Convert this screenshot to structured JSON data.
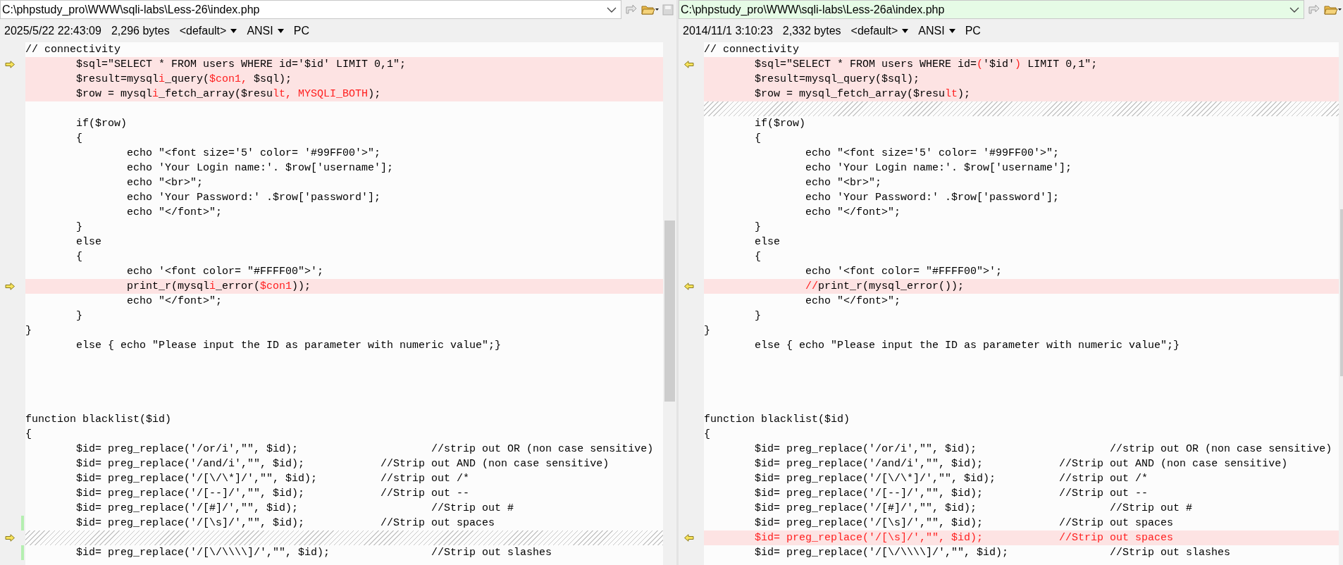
{
  "panes": [
    {
      "path": "C:\\phpstudy_pro\\WWW\\sqli-labs\\Less-26\\index.php",
      "path_active": false,
      "show_save": true,
      "info": {
        "timestamp": "2025/5/22 22:43:09",
        "size": "2,296 bytes",
        "codepage": "<default>",
        "encoding": "ANSI",
        "eol": "PC"
      },
      "lines": [
        {
          "kind": "plain",
          "text": "// connectivity"
        },
        {
          "kind": "changed",
          "arrow": true,
          "segments": [
            {
              "text": "\t$sql=\"SELECT * FROM users WHERE id='$id' LIMIT 0,1\";",
              "changed": false
            }
          ]
        },
        {
          "kind": "changed",
          "segments": [
            {
              "text": "\t$result=mysql",
              "changed": false
            },
            {
              "text": "i",
              "changed": true
            },
            {
              "text": "_query(",
              "changed": false
            },
            {
              "text": "$con1,",
              "changed": true
            },
            {
              "text": " $sql);",
              "changed": false
            }
          ]
        },
        {
          "kind": "changed",
          "segments": [
            {
              "text": "\t$row = mysql",
              "changed": false
            },
            {
              "text": "i",
              "changed": true
            },
            {
              "text": "_fetch_array($resu",
              "changed": false
            },
            {
              "text": "lt, MYSQLI_BOTH",
              "changed": true
            },
            {
              "text": ");",
              "changed": false
            }
          ]
        },
        {
          "kind": "empty"
        },
        {
          "kind": "plain",
          "text": "\tif($row)"
        },
        {
          "kind": "plain",
          "text": "\t{"
        },
        {
          "kind": "plain",
          "text": "\t\techo \"<font size='5' color= '#99FF00'>\";"
        },
        {
          "kind": "plain",
          "text": "\t\techo 'Your Login name:'. $row['username'];"
        },
        {
          "kind": "plain",
          "text": "\t\techo \"<br>\";"
        },
        {
          "kind": "plain",
          "text": "\t\techo 'Your Password:' .$row['password'];"
        },
        {
          "kind": "plain",
          "text": "\t\techo \"</font>\";"
        },
        {
          "kind": "plain",
          "text": "\t}"
        },
        {
          "kind": "plain",
          "text": "\telse"
        },
        {
          "kind": "plain",
          "text": "\t{"
        },
        {
          "kind": "plain",
          "text": "\t\techo '<font color= \"#FFFF00\">';"
        },
        {
          "kind": "changed",
          "arrow": true,
          "segments": [
            {
              "text": "\t\tprint_r(mysql",
              "changed": false
            },
            {
              "text": "i",
              "changed": true
            },
            {
              "text": "_error(",
              "changed": false
            },
            {
              "text": "$con1",
              "changed": true
            },
            {
              "text": "));",
              "changed": false
            }
          ]
        },
        {
          "kind": "plain",
          "text": "\t\techo \"</font>\";"
        },
        {
          "kind": "plain",
          "text": "\t}"
        },
        {
          "kind": "plain",
          "text": "}"
        },
        {
          "kind": "plain",
          "text": "\telse { echo \"Please input the ID as parameter with numeric value\";}"
        },
        {
          "kind": "empty"
        },
        {
          "kind": "empty"
        },
        {
          "kind": "empty"
        },
        {
          "kind": "empty"
        },
        {
          "kind": "plain",
          "text": "function blacklist($id)"
        },
        {
          "kind": "plain",
          "text": "{"
        },
        {
          "kind": "plain",
          "text": "\t$id= preg_replace('/or/i',\"\", $id);\t\t\t//strip out OR (non case sensitive)"
        },
        {
          "kind": "plain",
          "text": "\t$id= preg_replace('/and/i',\"\", $id);\t\t//Strip out AND (non case sensitive)"
        },
        {
          "kind": "plain",
          "text": "\t$id= preg_replace('/[\\/\\*]/',\"\", $id);\t\t//strip out /*"
        },
        {
          "kind": "plain",
          "text": "\t$id= preg_replace('/[--]/',\"\", $id);\t\t//Strip out --"
        },
        {
          "kind": "plain",
          "text": "\t$id= preg_replace('/[#]/',\"\", $id);\t\t\t//Strip out #"
        },
        {
          "kind": "plain",
          "moved": true,
          "text": "\t$id= preg_replace('/[\\s]/',\"\", $id);\t\t//Strip out spaces"
        },
        {
          "kind": "filler",
          "arrow": true
        },
        {
          "kind": "plain",
          "moved": true,
          "text": "\t$id= preg_replace('/[\\/\\\\\\\\]/',\"\", $id);\t\t//Strip out slashes"
        }
      ]
    },
    {
      "path": "C:\\phpstudy_pro\\WWW\\sqli-labs\\Less-26a\\index.php",
      "path_active": true,
      "show_save": false,
      "info": {
        "timestamp": "2014/11/1 3:10:23",
        "size": "2,332 bytes",
        "codepage": "<default>",
        "encoding": "ANSI",
        "eol": "PC"
      },
      "lines": [
        {
          "kind": "plain",
          "text": "// connectivity"
        },
        {
          "kind": "changed",
          "arrow": true,
          "segments": [
            {
              "text": "\t$sql=\"SELECT * FROM users WHERE id=",
              "changed": false
            },
            {
              "text": "(",
              "changed": true
            },
            {
              "text": "'$id'",
              "changed": false
            },
            {
              "text": ")",
              "changed": true
            },
            {
              "text": " LIMIT 0,1\";",
              "changed": false
            }
          ]
        },
        {
          "kind": "changed",
          "segments": [
            {
              "text": "\t$result=mysql_query($sql);",
              "changed": false
            }
          ]
        },
        {
          "kind": "changed",
          "segments": [
            {
              "text": "\t$row = mysql_fetch_array($resu",
              "changed": false
            },
            {
              "text": "lt",
              "changed": true
            },
            {
              "text": ");",
              "changed": false
            }
          ]
        },
        {
          "kind": "filler"
        },
        {
          "kind": "plain",
          "text": "\tif($row)"
        },
        {
          "kind": "plain",
          "text": "\t{"
        },
        {
          "kind": "plain",
          "text": "\t\techo \"<font size='5' color= '#99FF00'>\";"
        },
        {
          "kind": "plain",
          "text": "\t\techo 'Your Login name:'. $row['username'];"
        },
        {
          "kind": "plain",
          "text": "\t\techo \"<br>\";"
        },
        {
          "kind": "plain",
          "text": "\t\techo 'Your Password:' .$row['password'];"
        },
        {
          "kind": "plain",
          "text": "\t\techo \"</font>\";"
        },
        {
          "kind": "plain",
          "text": "\t}"
        },
        {
          "kind": "plain",
          "text": "\telse"
        },
        {
          "kind": "plain",
          "text": "\t{"
        },
        {
          "kind": "plain",
          "text": "\t\techo '<font color= \"#FFFF00\">';"
        },
        {
          "kind": "changed",
          "arrow": true,
          "segments": [
            {
              "text": "\t\t//",
              "changed": true
            },
            {
              "text": "print_r(mysql_error());",
              "changed": false
            }
          ]
        },
        {
          "kind": "plain",
          "text": "\t\techo \"</font>\";"
        },
        {
          "kind": "plain",
          "text": "\t}"
        },
        {
          "kind": "plain",
          "text": "}"
        },
        {
          "kind": "plain",
          "text": "\telse { echo \"Please input the ID as parameter with numeric value\";}"
        },
        {
          "kind": "empty"
        },
        {
          "kind": "empty"
        },
        {
          "kind": "empty"
        },
        {
          "kind": "empty"
        },
        {
          "kind": "plain",
          "text": "function blacklist($id)"
        },
        {
          "kind": "plain",
          "text": "{"
        },
        {
          "kind": "plain",
          "text": "\t$id= preg_replace('/or/i',\"\", $id);\t\t\t//strip out OR (non case sensitive)"
        },
        {
          "kind": "plain",
          "text": "\t$id= preg_replace('/and/i',\"\", $id);\t\t//Strip out AND (non case sensitive)"
        },
        {
          "kind": "plain",
          "text": "\t$id= preg_replace('/[\\/\\*]/',\"\", $id);\t\t//strip out /*"
        },
        {
          "kind": "plain",
          "text": "\t$id= preg_replace('/[--]/',\"\", $id);\t\t//Strip out --"
        },
        {
          "kind": "plain",
          "text": "\t$id= preg_replace('/[#]/',\"\", $id);\t\t\t//Strip out #"
        },
        {
          "kind": "plain",
          "text": "\t$id= preg_replace('/[\\s]/',\"\", $id);\t\t//Strip out spaces"
        },
        {
          "kind": "changed",
          "arrow": true,
          "segments": [
            {
              "text": "\t$id= preg_replace('/[\\s]/',\"\", $id);\t\t//Strip out spaces",
              "changed": true
            }
          ]
        },
        {
          "kind": "plain",
          "text": "\t$id= preg_replace('/[\\/\\\\\\\\]/',\"\", $id);\t\t//Strip out slashes"
        }
      ]
    }
  ]
}
